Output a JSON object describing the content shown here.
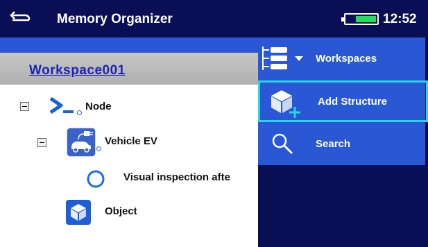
{
  "header": {
    "title": "Memory Organizer",
    "time": "12:52",
    "battery_level": 0.7
  },
  "workspace": {
    "name": "Workspace001"
  },
  "tree": {
    "items": [
      {
        "label": "Node",
        "icon": "prompt-icon"
      },
      {
        "label": "Vehicle EV",
        "icon": "vehicle-ev-icon"
      },
      {
        "label": "Visual inspection afte",
        "icon": "status-circle-icon"
      },
      {
        "label": "Object",
        "icon": "object-cube-icon"
      }
    ]
  },
  "menu": {
    "items": [
      {
        "label": "Workspaces",
        "icon": "workspaces-icon"
      },
      {
        "label": "Add Structure",
        "icon": "add-structure-icon",
        "selected": true
      },
      {
        "label": "Search",
        "icon": "search-icon"
      }
    ]
  },
  "colors": {
    "header_bg": "#0a0f55",
    "menu_bg": "#2a57d3",
    "selection_border": "#27d5f0",
    "workspace_text": "#1c24b8",
    "battery_fill": "#22e05a"
  }
}
